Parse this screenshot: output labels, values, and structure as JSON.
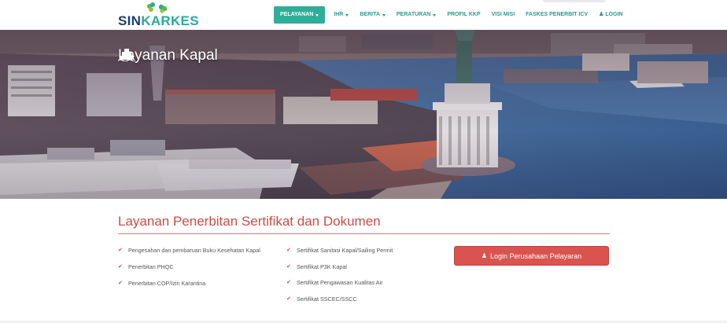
{
  "brand": {
    "part1": "SIN",
    "part2": "KARKES"
  },
  "nav": {
    "items": [
      {
        "label": "PELAYANAN",
        "active": true,
        "dropdown": true
      },
      {
        "label": "IHR",
        "dropdown": true
      },
      {
        "label": "BERITA",
        "dropdown": true
      },
      {
        "label": "PERATURAN",
        "dropdown": true
      },
      {
        "label": "PROFIL KKP",
        "dropdown": false
      },
      {
        "label": "VISI MISI",
        "dropdown": false
      },
      {
        "label": "FASKES PENERBIT ICV",
        "dropdown": false
      }
    ],
    "login": {
      "icon": "user-icon",
      "label": "LOGIN"
    }
  },
  "hero": {
    "icon": "ship-icon",
    "title": "Layanan Kapal"
  },
  "section": {
    "title": "Layanan Penerbitan Sertifikat dan Dokumen"
  },
  "list_left": [
    "Pengesahan dan pembaruan Buku Kesehatan Kapal",
    "Penerbitan PHQC",
    "Penerbitan COP/Izin Karantina"
  ],
  "list_right": [
    "Sertifikat Sanitasi Kapal/Sailing Permit",
    "Sertifikat P3K Kapal",
    "Sertifikat Pengawasan Kualitas Air",
    "Sertifikat SSCEC/SSCC"
  ],
  "login_button": {
    "icon": "user-icon",
    "label": "Login Perusahaan Pelayaran"
  },
  "colors": {
    "accent_teal": "#2fae97",
    "accent_red": "#d9534f",
    "brand_navy": "#1a3f6b"
  }
}
